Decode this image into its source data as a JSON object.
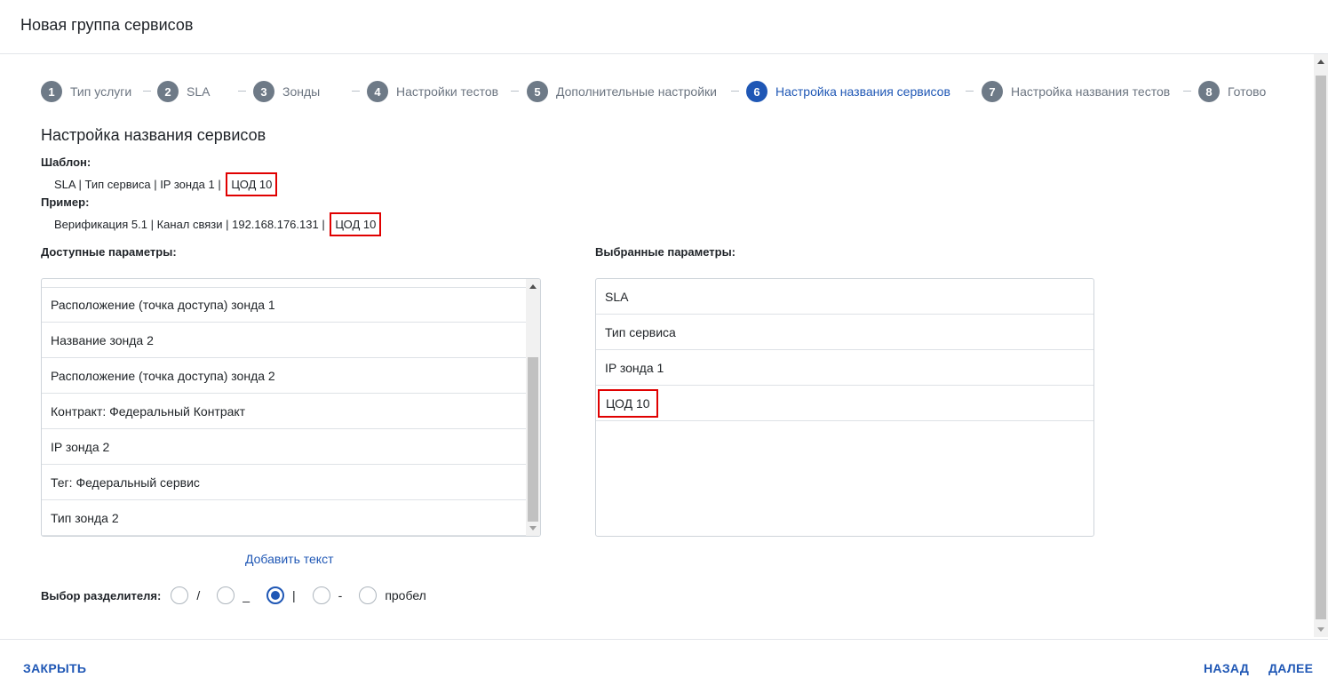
{
  "header": {
    "title": "Новая группа сервисов"
  },
  "stepper": {
    "steps": [
      {
        "num": "1",
        "label": "Тип услуги"
      },
      {
        "num": "2",
        "label": "SLA"
      },
      {
        "num": "3",
        "label": "Зонды"
      },
      {
        "num": "4",
        "label": "Настройки тестов"
      },
      {
        "num": "5",
        "label": "Дополнительные настройки"
      },
      {
        "num": "6",
        "label": "Настройка названия сервисов",
        "active": true
      },
      {
        "num": "7",
        "label": "Настройка названия тестов"
      },
      {
        "num": "8",
        "label": "Готово"
      }
    ]
  },
  "section_title": "Настройка названия сервисов",
  "template": {
    "label": "Шаблон:",
    "value": "SLA | Тип сервиса | IP зонда 1 |",
    "highlight": "ЦОД 10"
  },
  "example": {
    "label": "Пример:",
    "value": "Верификация 5.1 | Канал связи | 192.168.176.131 |",
    "highlight": "ЦОД 10"
  },
  "available": {
    "label": "Доступные параметры:",
    "items": [
      "Расположение (точка доступа) зонда 1",
      "Название зонда 2",
      "Расположение (точка доступа) зонда 2",
      "Контракт: Федеральный Контракт",
      "IP зонда 2",
      "Тег: Федеральный сервис",
      "Тип зонда 2"
    ]
  },
  "selected": {
    "label": "Выбранные параметры:",
    "items": [
      "SLA",
      "Тип сервиса",
      "IP зонда 1",
      "ЦОД 10"
    ]
  },
  "add_text": "Добавить текст",
  "separator": {
    "label": "Выбор разделителя:",
    "options": [
      {
        "label": "/",
        "checked": false
      },
      {
        "label": "_",
        "checked": false
      },
      {
        "label": "|",
        "checked": true
      },
      {
        "label": "-",
        "checked": false
      },
      {
        "label": "пробел",
        "checked": false
      }
    ]
  },
  "footer": {
    "close": "ЗАКРЫТЬ",
    "back": "НАЗАД",
    "next": "ДАЛЕЕ"
  },
  "colors": {
    "accent": "#1f57b5",
    "highlight_border": "#e00000",
    "step_inactive": "#6e7a87"
  }
}
